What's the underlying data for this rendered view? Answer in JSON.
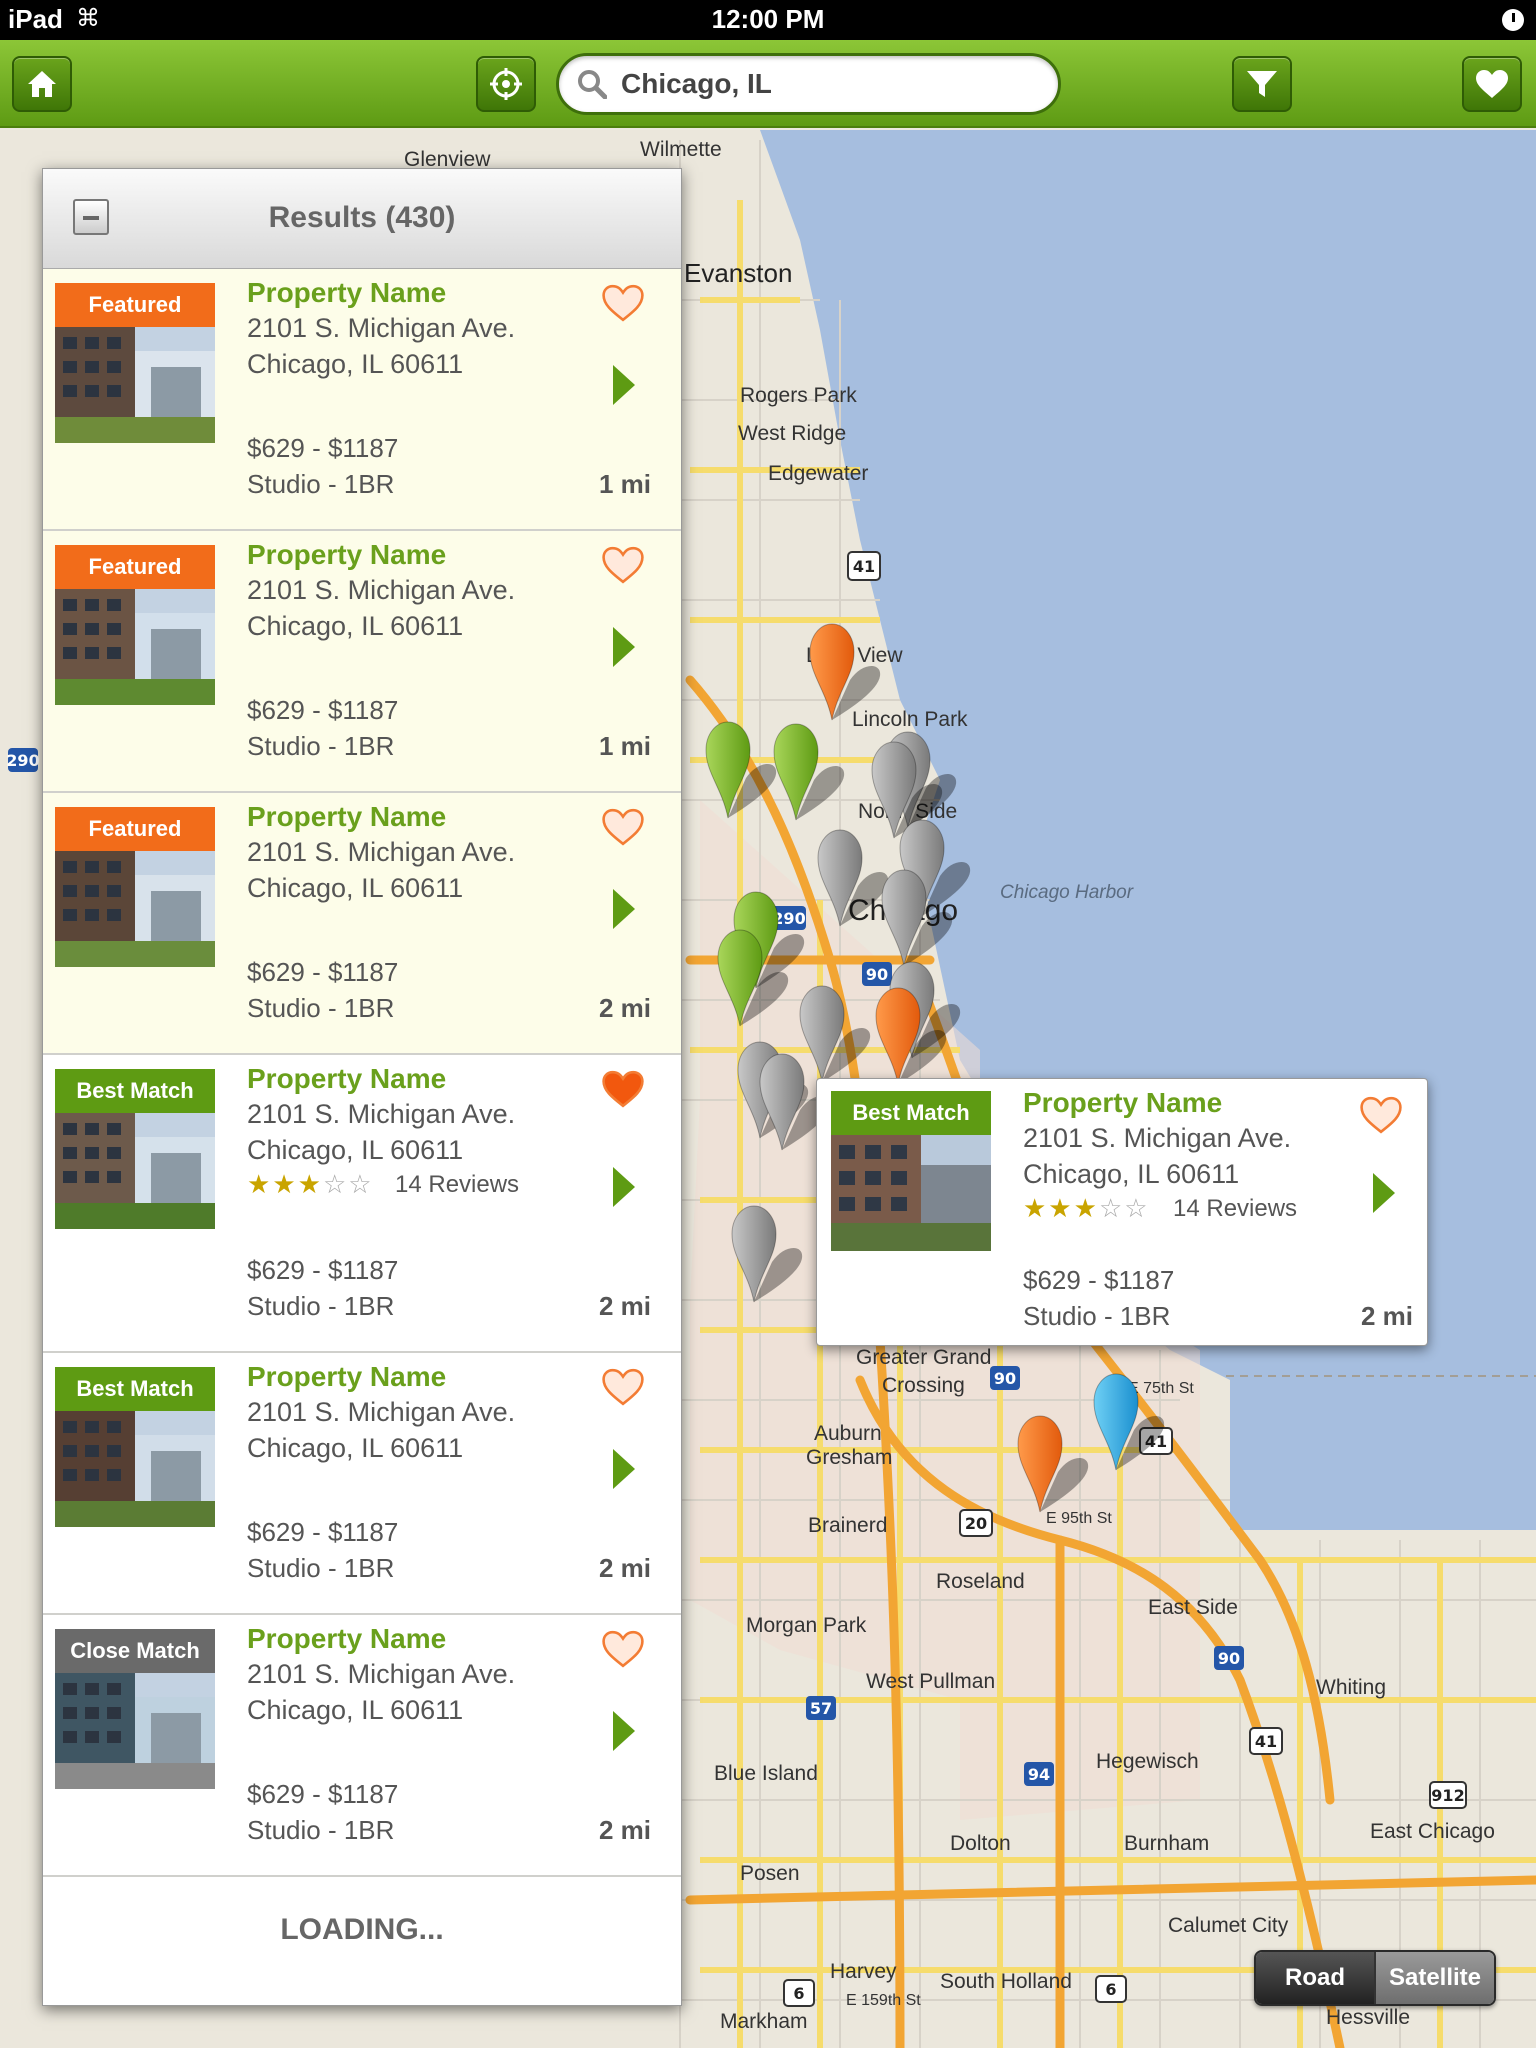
{
  "status_bar": {
    "carrier": "iPad",
    "time": "12:00 PM"
  },
  "toolbar": {
    "home_icon": "home-icon",
    "locate_icon": "crosshair-icon",
    "search_value": "Chicago, IL",
    "filter_icon": "filter-icon",
    "favorites_icon": "heart-icon"
  },
  "colors": {
    "brand_green": "#5e9b13",
    "accent_orange": "#f26c1a",
    "lake_blue": "#a6bedf"
  },
  "results": {
    "title": "Results (430)",
    "loading": "LOADING...",
    "listings": [
      {
        "badge": "Featured",
        "name": "Property Name",
        "addr1": "2101 S. Michigan Ave.",
        "addr2": "Chicago, IL 60611",
        "price": "$629 - $1187",
        "rooms": "Studio - 1BR",
        "dist": "1 mi",
        "favorited": false
      },
      {
        "badge": "Featured",
        "name": "Property Name",
        "addr1": "2101 S. Michigan Ave.",
        "addr2": "Chicago, IL 60611",
        "price": "$629 - $1187",
        "rooms": "Studio - 1BR",
        "dist": "1 mi",
        "favorited": false
      },
      {
        "badge": "Featured",
        "name": "Property Name",
        "addr1": "2101 S. Michigan Ave.",
        "addr2": "Chicago, IL 60611",
        "price": "$629 - $1187",
        "rooms": "Studio - 1BR",
        "dist": "2 mi",
        "favorited": false
      },
      {
        "badge": "Best Match",
        "name": "Property Name",
        "addr1": "2101 S. Michigan Ave.",
        "addr2": "Chicago, IL 60611",
        "rating": 3,
        "reviews": "14 Reviews",
        "price": "$629 - $1187",
        "rooms": "Studio - 1BR",
        "dist": "2 mi",
        "favorited": true
      },
      {
        "badge": "Best Match",
        "name": "Property Name",
        "addr1": "2101 S. Michigan Ave.",
        "addr2": "Chicago, IL 60611",
        "price": "$629 - $1187",
        "rooms": "Studio - 1BR",
        "dist": "2 mi",
        "favorited": false
      },
      {
        "badge": "Close Match",
        "name": "Property Name",
        "addr1": "2101 S. Michigan Ave.",
        "addr2": "Chicago, IL 60611",
        "price": "$629 - $1187",
        "rooms": "Studio - 1BR",
        "dist": "2 mi",
        "favorited": false
      }
    ]
  },
  "popup": {
    "badge": "Best Match",
    "name": "Property Name",
    "addr1": "2101 S. Michigan Ave.",
    "addr2": "Chicago, IL 60611",
    "rating": 3,
    "reviews": "14 Reviews",
    "price": "$629 - $1187",
    "rooms": "Studio - 1BR",
    "dist": "2 mi"
  },
  "map": {
    "labels": {
      "glenview": "Glenview",
      "wilmette": "Wilmette",
      "evanston": "Evanston",
      "rogers_park": "Rogers Park",
      "west_ridge": "West Ridge",
      "edgewater": "Edgewater",
      "lake_view": "Lake View",
      "lincoln_park": "Lincoln Park",
      "north_side": "North Side",
      "chicago": "Chicago",
      "harbor": "Chicago Harbor",
      "greater_grand": "Greater Grand",
      "crossing": "Crossing",
      "auburn": "Auburn",
      "gresham": "Gresham",
      "brainerd": "Brainerd",
      "roseland": "Roseland",
      "east_side": "East Side",
      "morgan_park": "Morgan Park",
      "west_pullman": "West Pullman",
      "hegewisch": "Hegewisch",
      "whiting": "Whiting",
      "blue_island": "Blue Island",
      "dolton": "Dolton",
      "burnham": "Burnham",
      "east_chicago": "East Chicago",
      "calumet_city": "Calumet City",
      "posen": "Posen",
      "harvey": "Harvey",
      "south_holland": "South Holland",
      "markham": "Markham",
      "hessville": "Hessville",
      "e75": "E 75th St",
      "e95": "E 95th St",
      "e159": "E 159th St"
    },
    "toggle": {
      "road": "Road",
      "satellite": "Satellite"
    }
  }
}
